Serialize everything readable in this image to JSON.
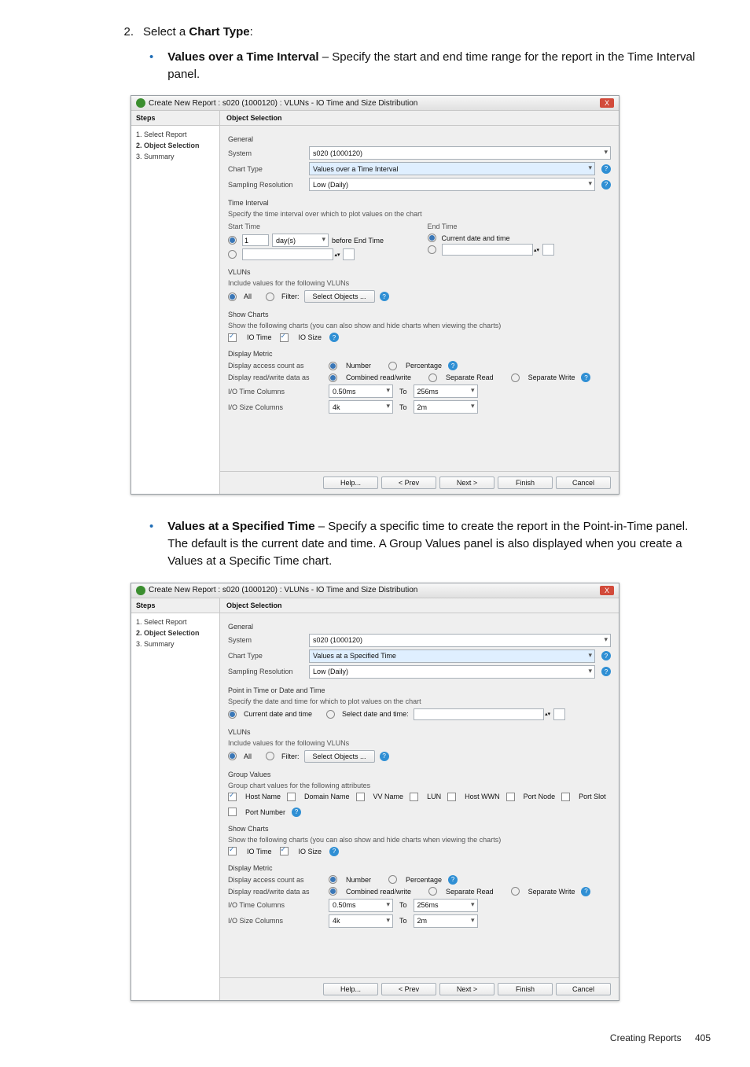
{
  "instruction": {
    "number": "2.",
    "text_prefix": "Select a ",
    "text_bold": "Chart Type",
    "text_suffix": ":"
  },
  "bullets": {
    "one": {
      "title": "Values over a Time Interval",
      "rest": " – Specify the start and end time range for the report in the Time Interval panel."
    },
    "two": {
      "title": "Values at a Specified Time",
      "rest": " – Specify a specific time to create the report in the Point-in-Time panel. The default is the current date and time. A Group Values panel is also displayed when you create a Values at a Specific Time chart."
    }
  },
  "dialog1": {
    "title": "Create New Report : s020 (1000120) : VLUNs - IO Time and Size Distribution",
    "steps_header": "Steps",
    "obj_header": "Object Selection",
    "steps": {
      "s1": "1. Select Report",
      "s2": "2. Object Selection",
      "s3": "3. Summary"
    },
    "general": {
      "label": "General",
      "system_l": "System",
      "system_v": "s020 (1000120)",
      "chart_l": "Chart Type",
      "chart_v": "Values over a Time Interval",
      "samp_l": "Sampling Resolution",
      "samp_v": "Low (Daily)"
    },
    "time": {
      "label": "Time Interval",
      "desc": "Specify the time interval over which to plot values on the chart",
      "start_l": "Start Time",
      "end_l": "End Time",
      "val_num": "1",
      "unit_v": "day(s)",
      "before": "before End Time",
      "current": "Current date and time"
    },
    "vluns": {
      "label": "VLUNs",
      "desc": "Include values for the following VLUNs",
      "all": "All",
      "filter": "Filter:",
      "select_btn": "Select Objects ..."
    },
    "show_charts": {
      "label": "Show Charts",
      "desc": "Show the following charts (you can also show and hide charts when viewing the charts)",
      "c1": "IO Time",
      "c2": "IO Size"
    },
    "metric": {
      "label": "Display Metric",
      "access_l": "Display access count as",
      "num": "Number",
      "pct": "Percentage",
      "rw_l": "Display read/write data as",
      "comb": "Combined read/write",
      "sr": "Separate Read",
      "sw": "Separate Write",
      "time_l": "I/O Time Columns",
      "from_t": "0.50ms",
      "to": "To",
      "to_t": "256ms",
      "size_l": "I/O Size Columns",
      "from_s": "4k",
      "to_s": "2m"
    },
    "buttons": {
      "help": "Help...",
      "prev": "< Prev",
      "next": "Next >",
      "finish": "Finish",
      "cancel": "Cancel"
    }
  },
  "dialog2": {
    "title": "Create New Report : s020 (1000120) : VLUNs - IO Time and Size Distribution",
    "general": {
      "chart_v": "Values at a Specified Time"
    },
    "pit": {
      "label": "Point in Time or Date and Time",
      "desc": "Specify the date and time for which to plot values on the chart",
      "current": "Current date and time",
      "select_dt": "Select date and time:"
    },
    "group": {
      "label": "Group Values",
      "desc": "Group chart values for the following attributes",
      "host": "Host Name",
      "domain": "Domain Name",
      "vv": "VV Name",
      "lun": "LUN",
      "wwn": "Host WWN",
      "node": "Port Node",
      "slot": "Port Slot",
      "num": "Port Number"
    }
  },
  "footer": {
    "text": "Creating Reports",
    "page": "405"
  }
}
